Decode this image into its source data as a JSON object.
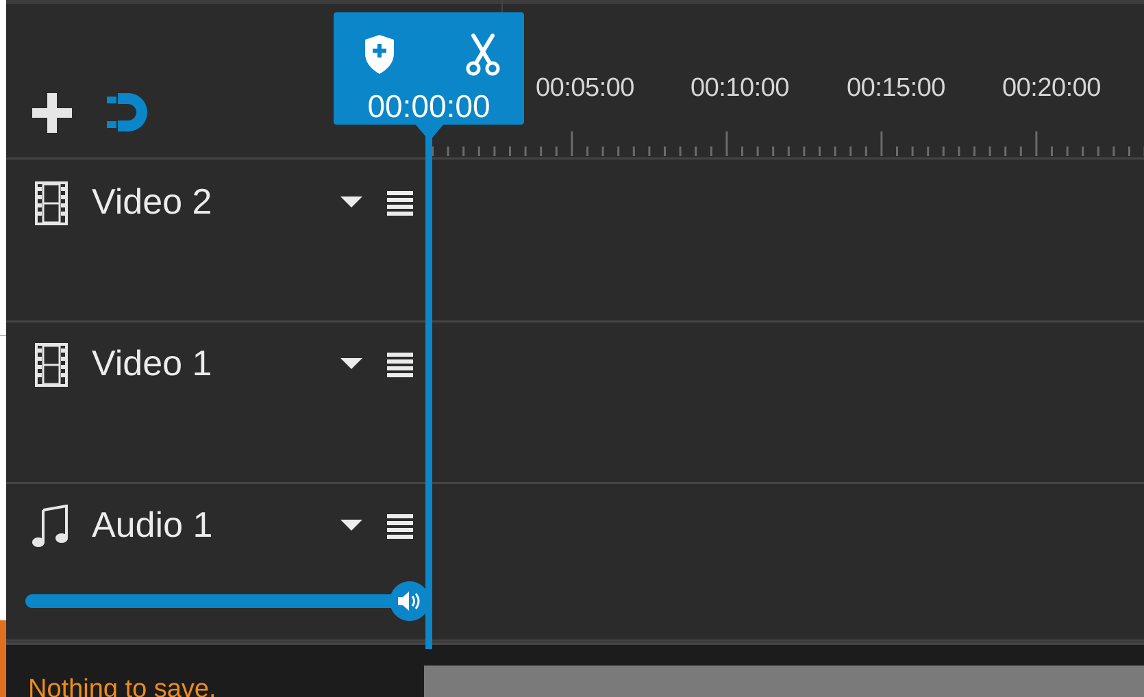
{
  "toolbar": {
    "add_track_icon": "plus-icon",
    "snap_icon": "magnet-icon",
    "snap_color": "#0a86c9"
  },
  "playhead": {
    "time": "00:00:00",
    "marker_icon": "shield-plus-icon",
    "split_icon": "scissors-icon",
    "color": "#0a86c9"
  },
  "ruler": {
    "labels": [
      "00:05:00",
      "00:10:00",
      "00:15:00",
      "00:20:00"
    ]
  },
  "tracks": [
    {
      "name": "Video 2",
      "icon": "film-icon"
    },
    {
      "name": "Video 1",
      "icon": "film-icon"
    },
    {
      "name": "Audio 1",
      "icon": "music-note-icon",
      "volume": 1.0
    }
  ],
  "status": {
    "message": "Nothing to save.",
    "color": "#f08c1a"
  }
}
